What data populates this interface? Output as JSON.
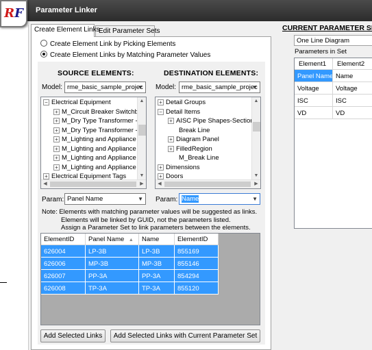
{
  "window": {
    "title": "Parameter Linker",
    "logo_text": "RF"
  },
  "tabs": [
    {
      "label": "Create Element Links",
      "active": true
    },
    {
      "label": "Edit Parameter Sets",
      "active": false
    }
  ],
  "modes": [
    {
      "label": "Create Element Link by Picking Elements",
      "selected": false
    },
    {
      "label": "Create Element Links by Matching Parameter Values",
      "selected": true
    }
  ],
  "source": {
    "heading": "SOURCE ELEMENTS:",
    "model_label": "Model:",
    "model_value": "rme_basic_sample_projec",
    "tree": [
      {
        "label": "Electrical Equipment",
        "level": 0,
        "toggle": "−"
      },
      {
        "label": "M_Circuit Breaker Switchb",
        "level": 1,
        "toggle": "+"
      },
      {
        "label": "M_Dry Type Transformer -",
        "level": 1,
        "toggle": "+"
      },
      {
        "label": "M_Dry Type Transformer -",
        "level": 1,
        "toggle": "+"
      },
      {
        "label": "M_Lighting and Appliance",
        "level": 1,
        "toggle": "+"
      },
      {
        "label": "M_Lighting and Appliance",
        "level": 1,
        "toggle": "+"
      },
      {
        "label": "M_Lighting and Appliance",
        "level": 1,
        "toggle": "+"
      },
      {
        "label": "M_Lighting and Appliance",
        "level": 1,
        "toggle": "+"
      },
      {
        "label": "Electrical Equipment Tags",
        "level": 0,
        "toggle": "+"
      }
    ],
    "param_label": "Param:",
    "param_value": "Panel Name"
  },
  "destination": {
    "heading": "DESTINATION ELEMENTS:",
    "model_label": "Model:",
    "model_value": "rme_basic_sample_projec",
    "tree": [
      {
        "label": "Detail Groups",
        "level": 0,
        "toggle": "+"
      },
      {
        "label": "Detail Items",
        "level": 0,
        "toggle": "−"
      },
      {
        "label": "AISC Pipe Shapes-Section",
        "level": 1,
        "toggle": "+"
      },
      {
        "label": "Break Line",
        "level": 1,
        "toggle": ""
      },
      {
        "label": "Diagram Panel",
        "level": 1,
        "toggle": "+"
      },
      {
        "label": "FilledRegion",
        "level": 1,
        "toggle": "+"
      },
      {
        "label": "M_Break Line",
        "level": 1,
        "toggle": ""
      },
      {
        "label": "Dimensions",
        "level": 0,
        "toggle": "+"
      },
      {
        "label": "Doors",
        "level": 0,
        "toggle": "+"
      }
    ],
    "param_label": "Param:",
    "param_value": "Name"
  },
  "note": {
    "line1": "Note: Elements with matching parameter values will be suggested as links.",
    "line2": "Elements will be linked by GUID, not the parameters listed.",
    "line3": "Assign a Parameter Set to link parameters between the elements."
  },
  "links_table": {
    "columns": [
      "ElementID",
      "Panel Name",
      "Name",
      "ElementID"
    ],
    "sort_indicator": "▲",
    "rows": [
      [
        "626004",
        "LP-3B",
        "LP-3B",
        "855169"
      ],
      [
        "626006",
        "MP-3B",
        "MP-3B",
        "855146"
      ],
      [
        "626007",
        "PP-3A",
        "PP-3A",
        "854294"
      ],
      [
        "626008",
        "TP-3A",
        "TP-3A",
        "855120"
      ]
    ]
  },
  "buttons": {
    "add_selected": "Add Selected Links",
    "add_with_set": "Add Selected Links with Current Parameter Set"
  },
  "current_set": {
    "title": "CURRENT PARAMETER SET:",
    "selected_set": "One Line Diagram",
    "params_label": "Parameters in Set",
    "columns": [
      "Element1",
      "Element2"
    ],
    "rows": [
      [
        "Panel Name",
        "Name"
      ],
      [
        "Voltage",
        "Voltage"
      ],
      [
        "ISC",
        "ISC"
      ],
      [
        "VD",
        "VD"
      ]
    ]
  },
  "colors": {
    "selection": "#3399ff",
    "titlebar": "#3a3a3a"
  }
}
